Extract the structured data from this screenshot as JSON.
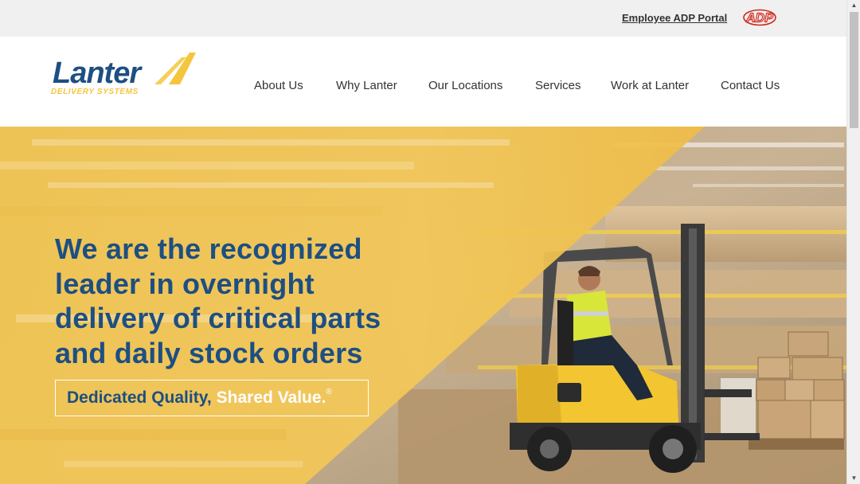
{
  "topbar": {
    "portal_link": "Employee ADP Portal",
    "adp_logo_text": "ADP"
  },
  "logo": {
    "name": "Lanter",
    "subtitle": "DELIVERY SYSTEMS"
  },
  "nav": {
    "items": [
      {
        "label": "About Us"
      },
      {
        "label": "Why Lanter"
      },
      {
        "label": "Our Locations"
      },
      {
        "label": "Services"
      },
      {
        "label": "Work at Lanter"
      },
      {
        "label": "Contact Us"
      }
    ]
  },
  "hero": {
    "headline": "We are the recognized leader in overnight delivery of critical parts and daily stock orders",
    "tagline_part1": "Dedicated Quality,",
    "tagline_part2": "Shared Value.",
    "tagline_reg": "®"
  },
  "colors": {
    "brand_blue": "#1d4f82",
    "brand_yellow": "#f4c53d",
    "adp_red": "#d0271d",
    "topbar_bg": "#f0f0f0"
  },
  "icons": {
    "scroll_up": "▲",
    "scroll_down": "▼"
  }
}
